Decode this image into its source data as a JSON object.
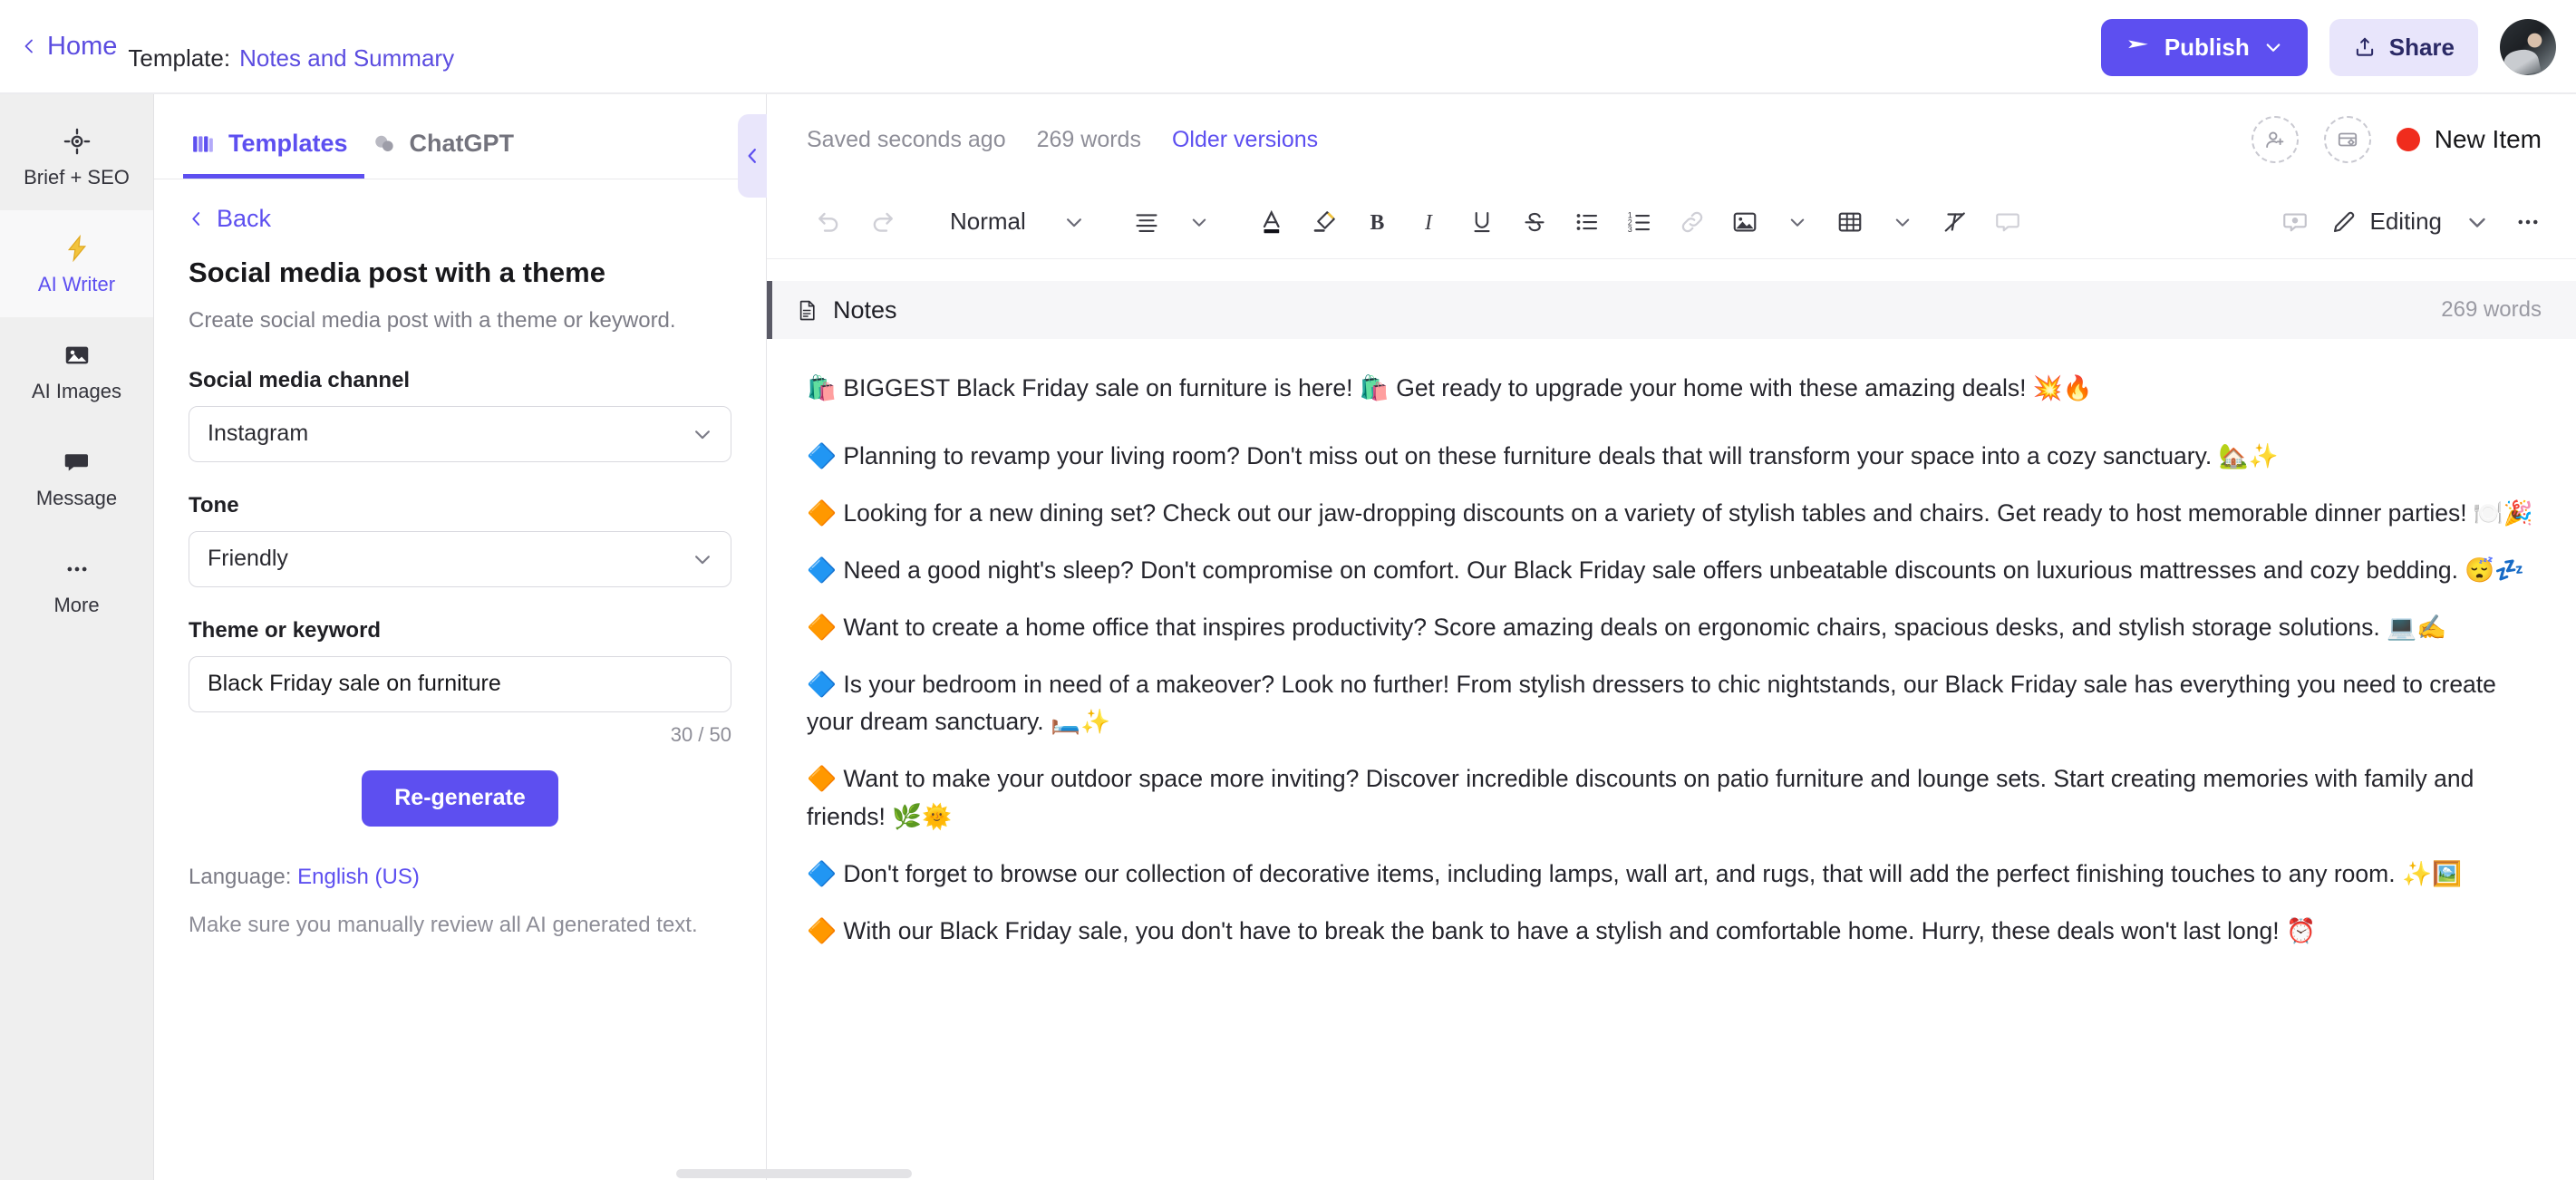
{
  "topbar": {
    "home_label": "Home",
    "template_label": "Template:",
    "template_name": "Notes and Summary",
    "publish_label": "Publish",
    "share_label": "Share"
  },
  "rail": {
    "items": [
      {
        "label": "Brief + SEO",
        "icon": "target-icon",
        "active": false
      },
      {
        "label": "AI Writer",
        "icon": "lightning-icon",
        "active": true
      },
      {
        "label": "AI Images",
        "icon": "image-icon",
        "active": false
      },
      {
        "label": "Message",
        "icon": "chat-bubble-icon",
        "active": false
      },
      {
        "label": "More",
        "icon": "ellipsis-icon",
        "active": false
      }
    ]
  },
  "panel": {
    "tabs": [
      {
        "label": "Templates",
        "icon": "books-icon",
        "active": true
      },
      {
        "label": "ChatGPT",
        "icon": "chat-icon",
        "active": false
      }
    ],
    "back_label": "Back",
    "title": "Social media post with a theme",
    "description": "Create social media post with a theme or keyword.",
    "fields": {
      "channel_label": "Social media channel",
      "channel_value": "Instagram",
      "tone_label": "Tone",
      "tone_value": "Friendly",
      "keyword_label": "Theme or keyword",
      "keyword_value": "Black Friday sale on furniture",
      "keyword_placeholder": "Theme or keyword",
      "counter": "30 / 50"
    },
    "regenerate_label": "Re-generate",
    "language_prefix": "Language:",
    "language_value": "English (US)",
    "disclaimer": "Make sure you manually review all AI generated text."
  },
  "editor": {
    "saved_status": "Saved seconds ago",
    "word_count": "269 words",
    "older_versions_label": "Older versions",
    "new_item_label": "New Item",
    "new_item_color": "#f02c1d",
    "toolbar": {
      "paragraph_style": "Normal",
      "editing_label": "Editing",
      "buttons": [
        "undo-icon",
        "redo-icon",
        "paragraph-style-dropdown",
        "align-icon",
        "text-color-icon",
        "highlight-icon",
        "bold-icon",
        "italic-icon",
        "underline-icon",
        "strikethrough-icon",
        "bullet-list-icon",
        "numbered-list-icon",
        "link-icon",
        "image-icon",
        "table-icon",
        "clear-format-icon",
        "comment-icon",
        "editing-mode",
        "more-icon"
      ]
    },
    "notes": {
      "title": "Notes",
      "word_count": "269 words"
    },
    "paragraphs": [
      "🛍️ BIGGEST Black Friday sale on furniture is here! 🛍️ Get ready to upgrade your home with these amazing deals! 💥🔥",
      "🔷 Planning to revamp your living room? Don't miss out on these furniture deals that will transform your space into a cozy sanctuary. 🏡✨",
      "🔶 Looking for a new dining set? Check out our jaw-dropping discounts on a variety of stylish tables and chairs. Get ready to host memorable dinner parties! 🍽️🎉",
      "🔷 Need a good night's sleep? Don't compromise on comfort. Our Black Friday sale offers unbeatable discounts on luxurious mattresses and cozy bedding. 😴💤",
      "🔶 Want to create a home office that inspires productivity? Score amazing deals on ergonomic chairs, spacious desks, and stylish storage solutions. 💻✍️",
      "🔷 Is your bedroom in need of a makeover? Look no further! From stylish dressers to chic nightstands, our Black Friday sale has everything you need to create your dream sanctuary. 🛏️✨",
      "🔶 Want to make your outdoor space more inviting? Discover incredible discounts on patio furniture and lounge sets. Start creating memories with family and friends! 🌿🌞",
      "🔷 Don't forget to browse our collection of decorative items, including lamps, wall art, and rugs, that will add the perfect finishing touches to any room. ✨🖼️",
      "🔶 With our Black Friday sale, you don't have to break the bank to have a stylish and comfortable home. Hurry, these deals won't last long! ⏰"
    ]
  },
  "colors": {
    "accent": "#5d4ff0",
    "accent_soft": "#e8e5fb",
    "rail_bg": "#efefef",
    "status_red": "#f02c1d"
  }
}
